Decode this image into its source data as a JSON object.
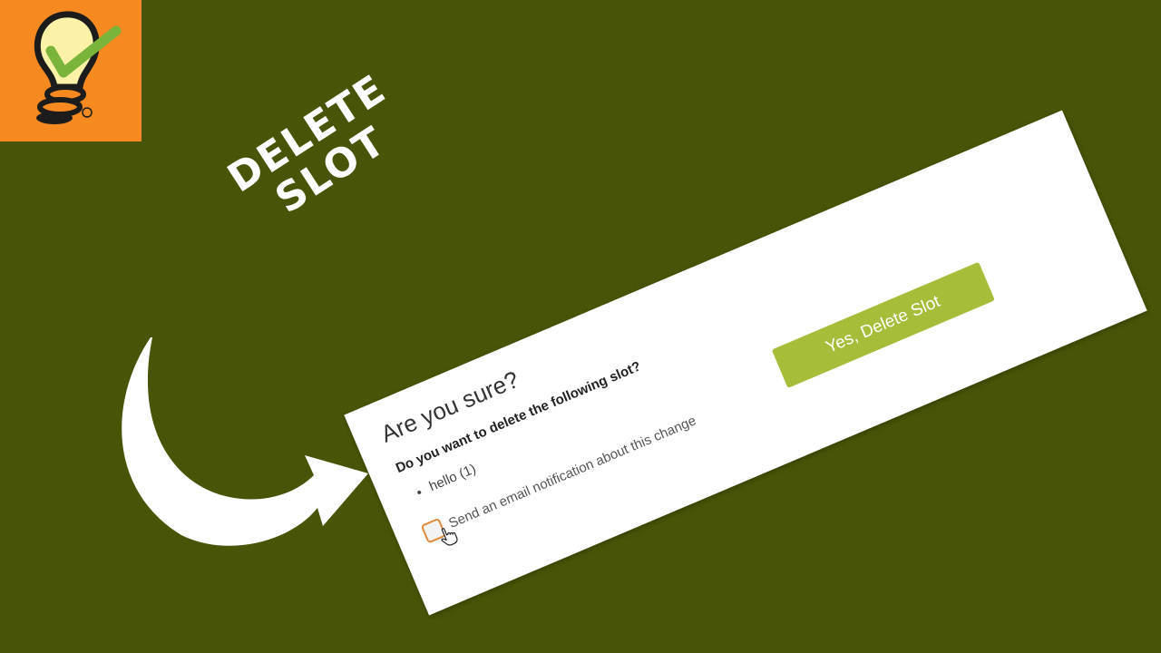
{
  "headline": {
    "line1": "DELETE",
    "line2": "SLOT"
  },
  "dialog": {
    "title": "Are you sure?",
    "question": "Do you want to delete the following slot?",
    "slot_items": [
      "hello (1)"
    ],
    "notify_label": "Send an email notification about this change",
    "notify_checked": false,
    "confirm_label": "Yes, Delete Slot"
  },
  "colors": {
    "background": "#485407",
    "logo_tile": "#f6891f",
    "confirm_button": "#a6bd3a",
    "checkbox_border": "#e08a3c"
  },
  "icons": [
    "lightbulb-check-logo-icon",
    "registered-mark-icon",
    "curved-arrow-icon",
    "hand-pointer-cursor-icon"
  ]
}
